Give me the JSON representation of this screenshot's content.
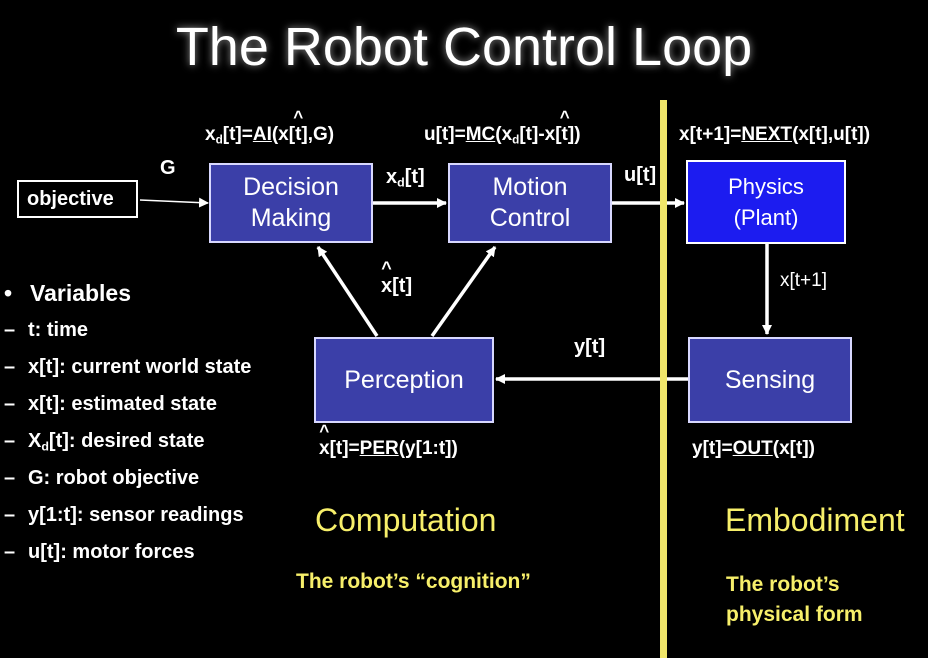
{
  "title": "The Robot Control Loop",
  "boxes": {
    "decision": "Decision\nMaking",
    "motion": "Motion\nControl",
    "physics": "Physics\n(Plant)",
    "perception": "Perception",
    "sensing": "Sensing",
    "objective": "objective"
  },
  "equations": {
    "ai_lhs": "x",
    "ai_sub": "d",
    "ai_mid": "[t]=",
    "ai_func": "AI",
    "ai_open": "(x",
    "ai_hat": "[t]",
    "ai_rest": ",G)",
    "mc_pre": "u[t]=",
    "mc_func": "MC",
    "mc_open": "(x",
    "mc_sub": "d",
    "mc_mid": "[t]-x",
    "mc_hat": "[t]",
    "mc_close": ")",
    "next_pre": "x[t+1]=",
    "next_func": "NEXT",
    "next_rest": "(x[t],u[t])",
    "per_x": "x",
    "per_pre": "[t]=",
    "per_func": "PER",
    "per_rest": "(y[1:t])",
    "out_pre": "y[t]=",
    "out_func": "OUT",
    "out_rest": "(x[t])"
  },
  "signals": {
    "g": "G",
    "xd_x": "x",
    "xd_sub": "d",
    "xd_rest": "[t]",
    "u": "u[t]",
    "xt1": "x[t+1]",
    "y": "y[t]",
    "xhat_x": "x",
    "xhat_rest": "[t]"
  },
  "legend": {
    "heading": "Variables",
    "items": [
      "t: time",
      "x[t]: current world state",
      "x[t]: estimated state",
      "X",
      "G: robot objective",
      "y[1:t]: sensor readings",
      "u[t]: motor forces"
    ],
    "xd_sub": "d",
    "xd_rest": "[t]: desired state"
  },
  "sections": {
    "computation": "Computation",
    "computation_sub": "The robot’s “cognition”",
    "embodiment": "Embodiment",
    "embodiment_sub": "The robot’s\nphysical form"
  },
  "colors": {
    "background": "#000000",
    "box_fill": "#3b3fa8",
    "physics_fill": "#1c1cf0",
    "accent_yellow": "#f7ef6a",
    "divider": "#f0e66a"
  }
}
